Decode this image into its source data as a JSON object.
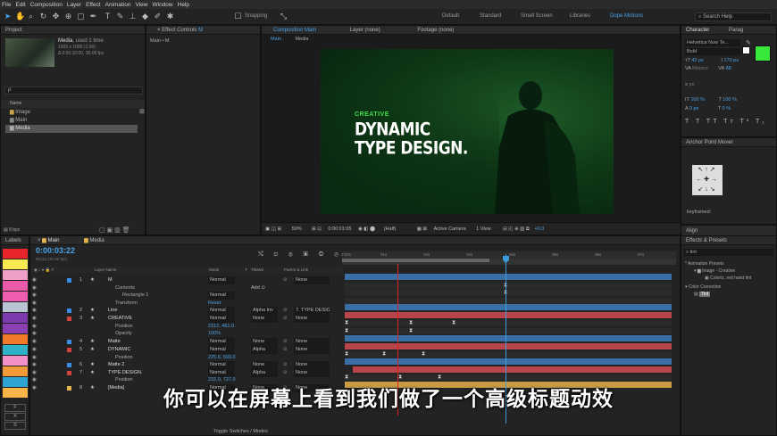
{
  "menu": [
    "File",
    "Edit",
    "Composition",
    "Layer",
    "Effect",
    "Animation",
    "View",
    "Window",
    "Help"
  ],
  "workspaces": [
    "Default",
    "Standard",
    "Small Screen",
    "Libraries",
    "Dope Motions"
  ],
  "search_placeholder": "Search Help",
  "snapping": "Snapping",
  "project": {
    "title": "Project",
    "item_name": "Media",
    "item_used": ", used 1 time",
    "item_size": "1920 x 1080 (1.00)",
    "item_duration": "Δ 0:00:10:00, 30.00 fps",
    "search_prefix": "ρ",
    "col_name": "Name",
    "items": [
      "Image",
      "Main",
      "Media"
    ],
    "bpc": "8 bpc"
  },
  "effect_controls": {
    "title": "Effect Controls",
    "sub": "M",
    "breadcrumb": "Main • M"
  },
  "composition": {
    "tab": "Composition Main",
    "layer_tab": "Layer  (none)",
    "footage_tab": "Footage  (none)",
    "nav": [
      "Main",
      "Media"
    ],
    "creative": "CREATIVE",
    "line1": "DYNAMIC",
    "line2": "TYPE DESIGN.",
    "zoom": "50%",
    "time": "0:00:01:05",
    "res": "(Half)",
    "camera": "Active Camera",
    "views": "1 View",
    "offset": "+0.0"
  },
  "character": {
    "title": "Character",
    "title2": "Parag",
    "font": "Helvetica Now Te...",
    "style": "Bold",
    "size": "42 px",
    "leading": "170 px",
    "kerning": "Metrics",
    "tracking": "88",
    "stroke": "px",
    "vscale": "100 %",
    "hscale": "100 %",
    "baseline": "0 px",
    "tsume": "0 %",
    "fill_color": "#38e83a"
  },
  "anchor": {
    "title": "Anchor Point Mover",
    "keyframed": "keyframed:"
  },
  "align": {
    "title": "Align"
  },
  "effects": {
    "title": "Effects & Presets",
    "search": "tint",
    "folder1": "* Animation Presets",
    "sub1": "Image - Creative",
    "item1": "Coloriz..red hand tint",
    "folder2": "Color Correction",
    "item2": "Tint"
  },
  "labels_panel": {
    "title": "Labels",
    "buttons": [
      "F",
      "X",
      "S"
    ]
  },
  "timeline": {
    "tabs": [
      "Main",
      "Media"
    ],
    "timecode": "0:00:03:22",
    "fps_info": "00112 (30.00 fps)",
    "columns": [
      "Layer Name",
      "Mode",
      "T",
      "TrkMat",
      "Parent & Link"
    ],
    "ticks": [
      "0:00s",
      "01s",
      "02s",
      "03s",
      "04s",
      "05s",
      "06s",
      "07s"
    ],
    "rows": [
      {
        "num": "1",
        "name": "M",
        "mode": "Normal",
        "trk": "",
        "parent": "None"
      },
      {
        "num": "",
        "name": "Contents",
        "mode": "",
        "trk": "Add ⊙",
        "parent": ""
      },
      {
        "num": "",
        "name": "Rectangle 1",
        "mode": "Normal",
        "trk": "",
        "parent": ""
      },
      {
        "num": "",
        "name": "Transform",
        "mode": "Reset",
        "trk": "",
        "parent": ""
      },
      {
        "num": "2",
        "name": "Line",
        "mode": "Normal",
        "trk": "Alpha Inv",
        "parent": "7. TYPE DESIG"
      },
      {
        "num": "3",
        "name": "CREATIVE",
        "mode": "Normal",
        "trk": "None",
        "parent": "None"
      },
      {
        "num": "",
        "name": "Position",
        "mode": "2312, 461.0",
        "trk": "",
        "parent": ""
      },
      {
        "num": "",
        "name": "Opacity",
        "mode": "100%",
        "trk": "",
        "parent": ""
      },
      {
        "num": "4",
        "name": "Matte",
        "mode": "Normal",
        "trk": "None",
        "parent": "None"
      },
      {
        "num": "5",
        "name": "DYNAMIC",
        "mode": "Normal",
        "trk": "Alpha",
        "parent": "None"
      },
      {
        "num": "",
        "name": "Position",
        "mode": "225.6, 593.0",
        "trk": "",
        "parent": ""
      },
      {
        "num": "6",
        "name": "Matte 2",
        "mode": "Normal",
        "trk": "None",
        "parent": "None"
      },
      {
        "num": "7",
        "name": "TYPE DESIGN.",
        "mode": "Normal",
        "trk": "Alpha",
        "parent": "None"
      },
      {
        "num": "",
        "name": "Position",
        "mode": "232.0, 727.0",
        "trk": "",
        "parent": ""
      },
      {
        "num": "8",
        "name": "[Media]",
        "mode": "Normal",
        "trk": "None",
        "parent": "None"
      }
    ],
    "toggle_label": "Toggle Switches / Modes"
  },
  "subtitle": "你可以在屏幕上看到我们做了一个高级标题动效",
  "colors": {
    "accent": "#2d8ceb",
    "comp_bg": "#0a2a10",
    "green_text": "#3fe04a",
    "bar_blue": "#3a6fa6",
    "bar_red": "#b8444c",
    "bar_gold": "#c79a43"
  }
}
